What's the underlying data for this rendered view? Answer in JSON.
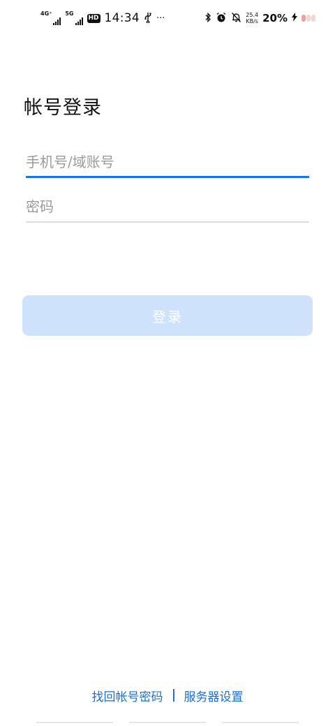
{
  "status_bar": {
    "network1": "4G⁺",
    "network2": "5G",
    "hd": "HD",
    "time": "14:34",
    "usb_icon": "usb-icon",
    "more": "···",
    "bluetooth_icon": "bluetooth-icon",
    "alarm_icon": "alarm-icon",
    "mute_icon": "bell-off-icon",
    "speed_value": "25.4",
    "speed_unit": "KB/s",
    "battery_percent": "20%",
    "charging_icon": "charging-icon"
  },
  "login": {
    "title": "帐号登录",
    "account_placeholder": "手机号/域账号",
    "account_value": "",
    "password_placeholder": "密码",
    "password_value": "",
    "submit_label": "登录"
  },
  "footer": {
    "recover_label": "找回帐号密码",
    "server_label": "服务器设置"
  },
  "colors": {
    "accent": "#1677e5",
    "link": "#1a6fd1",
    "button_disabled": "#cfe2fb"
  }
}
